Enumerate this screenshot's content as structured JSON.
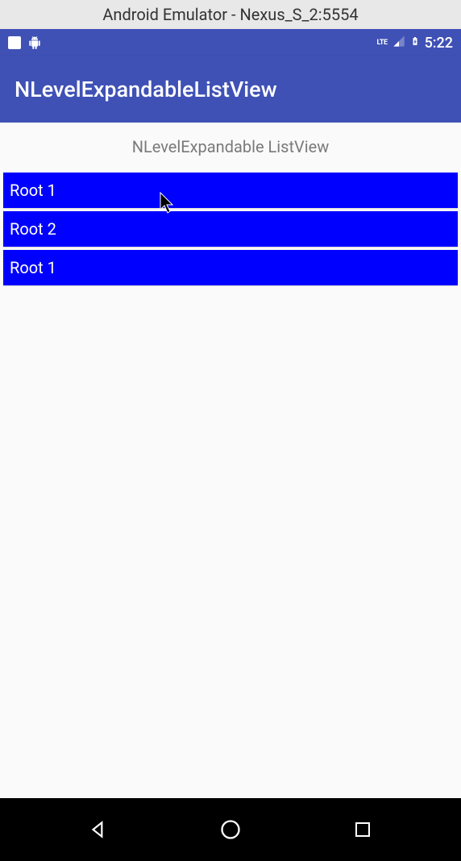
{
  "emulator": {
    "title": "Android Emulator - Nexus_S_2:5554"
  },
  "status_bar": {
    "network_label": "LTE",
    "time": "5:22"
  },
  "app_bar": {
    "title": "NLevelExpandableListView"
  },
  "content": {
    "subtitle": "NLevelExpandable ListView"
  },
  "list": {
    "items": [
      {
        "label": "Root 1"
      },
      {
        "label": "Root 2"
      },
      {
        "label": "Root 1"
      }
    ]
  }
}
